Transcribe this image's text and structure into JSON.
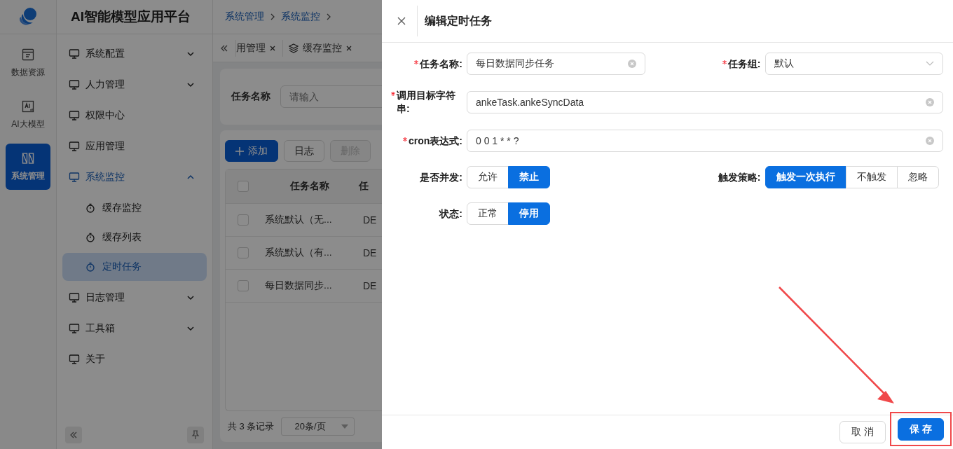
{
  "app": {
    "title": "AI智能模型应用平台"
  },
  "rail": [
    {
      "label": "数据资源",
      "selected": false
    },
    {
      "label": "AI大模型",
      "selected": false
    },
    {
      "label": "系统管理",
      "selected": true
    }
  ],
  "sidebar": {
    "items": [
      {
        "label": "系统配置",
        "kind": "group",
        "expanded": false,
        "selected": false
      },
      {
        "label": "人力管理",
        "kind": "group",
        "expanded": false,
        "selected": false
      },
      {
        "label": "权限中心",
        "kind": "link",
        "selected": false
      },
      {
        "label": "应用管理",
        "kind": "link",
        "selected": false
      },
      {
        "label": "系统监控",
        "kind": "group",
        "expanded": true,
        "selected": true,
        "children": [
          {
            "label": "缓存监控",
            "selected": false
          },
          {
            "label": "缓存列表",
            "selected": false
          },
          {
            "label": "定时任务",
            "selected": true
          }
        ]
      },
      {
        "label": "日志管理",
        "kind": "group",
        "expanded": false,
        "selected": false
      },
      {
        "label": "工具箱",
        "kind": "group",
        "expanded": false,
        "selected": false
      },
      {
        "label": "关于",
        "kind": "link",
        "selected": false
      }
    ]
  },
  "breadcrumb": [
    "系统管理",
    "系统监控"
  ],
  "tabs": [
    {
      "label": "用管理",
      "selected": false
    },
    {
      "label": "缓存监控",
      "selected": false
    }
  ],
  "search": {
    "label": "任务名称",
    "placeholder": "请输入"
  },
  "toolbar": [
    {
      "label": "添加",
      "kind": "primary",
      "disabled": false
    },
    {
      "label": "日志",
      "kind": "default",
      "disabled": false
    },
    {
      "label": "删除",
      "kind": "default",
      "disabled": true
    }
  ],
  "table": {
    "header_checked": false,
    "columns": [
      "任务名称",
      "任"
    ],
    "rows": [
      {
        "checked": false,
        "cells": [
          "系统默认（无...",
          "DE"
        ]
      },
      {
        "checked": false,
        "cells": [
          "系统默认（有...",
          "DE"
        ]
      },
      {
        "checked": false,
        "cells": [
          "每日数据同步...",
          "DE"
        ]
      }
    ]
  },
  "pagination": {
    "total": "共 3 条记录",
    "page_size": "20条/页"
  },
  "drawer": {
    "title": "编辑定时任务",
    "rows": [
      [
        {
          "kind": "text",
          "label": "任务名称:",
          "required": true,
          "value": "每日数据同步任务"
        },
        {
          "kind": "select",
          "label": "任务组:",
          "required": true,
          "value": "默认"
        }
      ],
      [
        {
          "kind": "text",
          "label": "调用目标字符串:",
          "required": true,
          "value": "ankeTask.ankeSyncData"
        }
      ],
      [
        {
          "kind": "text",
          "label": "cron表达式:",
          "required": true,
          "value": "0 0 1 * * ?"
        }
      ],
      [
        {
          "kind": "radio",
          "label": "是否并发:",
          "required": false,
          "options": [
            {
              "label": "允许",
              "selected": false
            },
            {
              "label": "禁止",
              "selected": true
            }
          ]
        },
        {
          "kind": "radio",
          "label": "触发策略:",
          "required": false,
          "options": [
            {
              "label": "触发一次执行",
              "selected": true
            },
            {
              "label": "不触发",
              "selected": false
            },
            {
              "label": "忽略",
              "selected": false
            }
          ]
        }
      ],
      [
        {
          "kind": "radio",
          "label": "状态:",
          "required": false,
          "options": [
            {
              "label": "正常",
              "selected": false
            },
            {
              "label": "停用",
              "selected": true
            }
          ]
        }
      ]
    ],
    "buttons": [
      {
        "label": "取 消",
        "kind": "default"
      },
      {
        "label": "保 存",
        "kind": "primary",
        "highlighted": true
      }
    ]
  }
}
